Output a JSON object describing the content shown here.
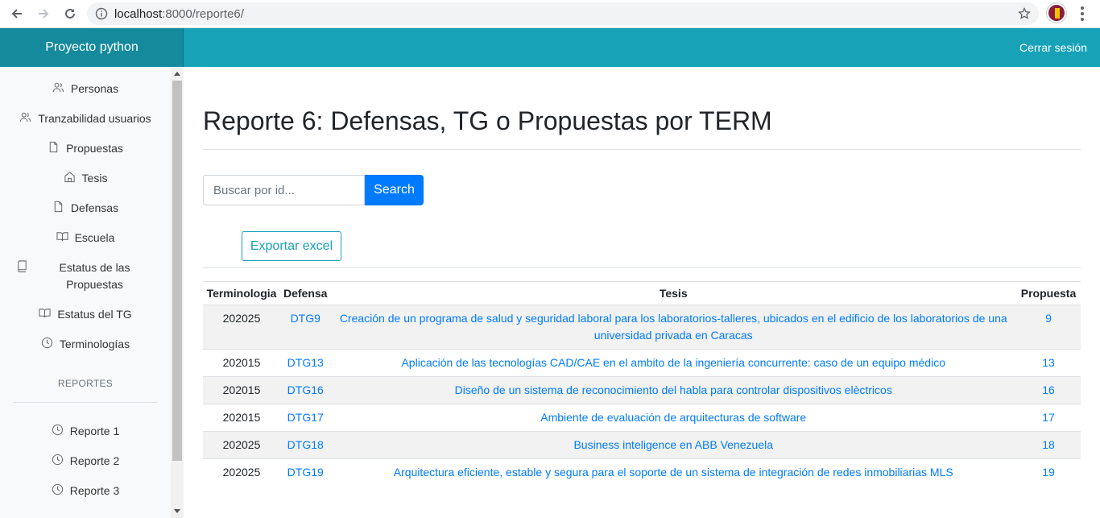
{
  "browser": {
    "url_host": "localhost",
    "url_rest": ":8000/reporte6/"
  },
  "navbar": {
    "brand": "Proyecto python",
    "logout": "Cerrar sesión"
  },
  "sidebar": {
    "items": [
      {
        "label": "Personas",
        "icon": "users-icon"
      },
      {
        "label": "Tranzabilidad usuarios",
        "icon": "users-icon"
      },
      {
        "label": "Propuestas",
        "icon": "file-icon"
      },
      {
        "label": "Tesis",
        "icon": "home-icon"
      },
      {
        "label": "Defensas",
        "icon": "file-icon"
      },
      {
        "label": "Escuela",
        "icon": "book-open-icon"
      },
      {
        "label": "Estatus de las Propuestas",
        "icon": "book-icon"
      },
      {
        "label": "Estatus del TG",
        "icon": "book-open-icon"
      },
      {
        "label": "Terminologías",
        "icon": "clock-icon"
      }
    ],
    "reports_heading": "REPORTES",
    "reports": [
      {
        "label": "Reporte 1",
        "icon": "clock-icon"
      },
      {
        "label": "Reporte 2",
        "icon": "clock-icon"
      },
      {
        "label": "Reporte 3",
        "icon": "clock-icon"
      }
    ]
  },
  "main": {
    "title": "Reporte 6: Defensas, TG o Propuestas por TERM",
    "search_placeholder": "Buscar por id...",
    "search_label": "Search",
    "export_label": "Exportar excel"
  },
  "table": {
    "headers": [
      "Terminologia",
      "Defensa",
      "Tesis",
      "Propuesta"
    ],
    "rows": [
      {
        "term": "202025",
        "defensa": "DTG9",
        "tesis": "Creación de un programa de salud y seguridad laboral para los laboratorios-talleres, ubicados en el edificio de los laboratorios de una universidad privada en Caracas",
        "propuesta": "9"
      },
      {
        "term": "202015",
        "defensa": "DTG13",
        "tesis": "Aplicación de las tecnologías CAD/CAE en el ambito de la ingeniería concurrente: caso de un equipo médico",
        "propuesta": "13"
      },
      {
        "term": "202015",
        "defensa": "DTG16",
        "tesis": "Diseño de un sistema de reconocimiento del habla para controlar dispositivos elèctricos",
        "propuesta": "16"
      },
      {
        "term": "202015",
        "defensa": "DTG17",
        "tesis": "Ambiente de evaluación de arquitecturas de software",
        "propuesta": "17"
      },
      {
        "term": "202025",
        "defensa": "DTG18",
        "tesis": "Business inteligence en ABB Venezuela",
        "propuesta": "18"
      },
      {
        "term": "202025",
        "defensa": "DTG19",
        "tesis": "Arquitectura eficiente, estable y segura para el soporte de un sistema de integración de redes inmobiliarias MLS",
        "propuesta": "19"
      }
    ]
  },
  "colors": {
    "navbar": "#17a2b8",
    "brand": "#148a9c",
    "primary": "#007bff"
  }
}
